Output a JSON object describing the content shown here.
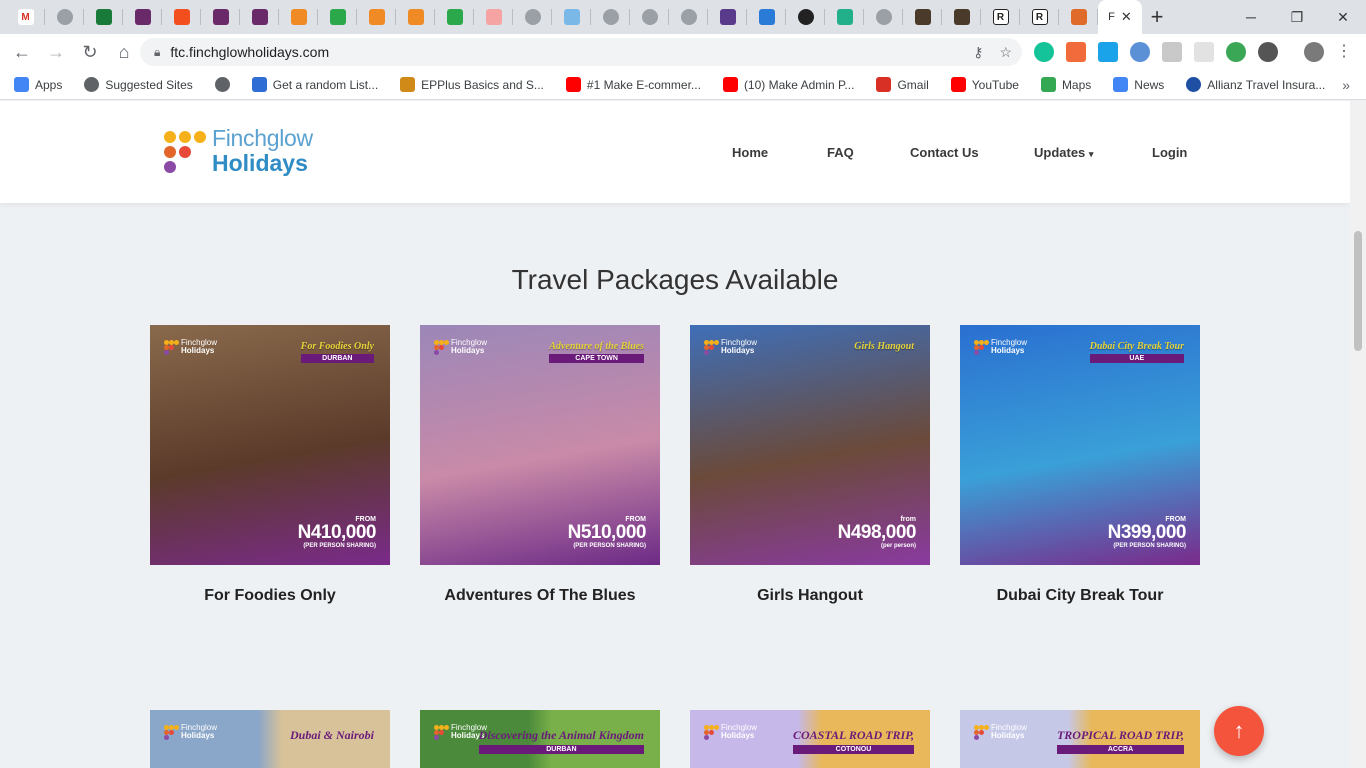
{
  "browser": {
    "active_tab_label": "F",
    "url": "ftc.finchglowholidays.com",
    "tab_favicons": [
      "gmail-icon",
      "globe-icon",
      "grid-icon",
      "grid-icon",
      "figma-icon",
      "grid-icon",
      "grid-icon",
      "box-icon",
      "timer-icon",
      "box-icon",
      "box-icon",
      "timer-icon",
      "laravel-icon",
      "shield-icon",
      "check-icon",
      "globe-icon",
      "shield-icon",
      "shield-icon",
      "bootstrap-icon",
      "code-icon",
      "github-icon",
      "diamond-icon",
      "globe-icon",
      "book-icon",
      "book-icon",
      "r-icon",
      "r-icon",
      "fox-icon"
    ],
    "bookmarks": [
      {
        "label": "Apps",
        "icon": "apps-grid-icon",
        "color": "#4285f4"
      },
      {
        "label": "Suggested Sites",
        "icon": "globe-icon",
        "color": "#5f6368"
      },
      {
        "label": "",
        "icon": "globe-icon",
        "color": "#5f6368"
      },
      {
        "label": "Get a random List...",
        "icon": "arrow-icon",
        "color": "#2f6dd4"
      },
      {
        "label": "EPPlus Basics and S...",
        "icon": "tile-icon",
        "color": "#d08a18"
      },
      {
        "label": "#1 Make E-commer...",
        "icon": "youtube-icon",
        "color": "#ff0000"
      },
      {
        "label": "(10) Make Admin P...",
        "icon": "youtube-icon",
        "color": "#ff0000"
      },
      {
        "label": "Gmail",
        "icon": "gmail-icon",
        "color": "#d93025"
      },
      {
        "label": "YouTube",
        "icon": "youtube-icon",
        "color": "#ff0000"
      },
      {
        "label": "Maps",
        "icon": "maps-icon",
        "color": "#34a853"
      },
      {
        "label": "News",
        "icon": "news-icon",
        "color": "#4285f4"
      },
      {
        "label": "Allianz Travel Insura...",
        "icon": "allianz-icon",
        "color": "#1f4fa3"
      }
    ]
  },
  "site": {
    "logo": {
      "line1": "Finchglow",
      "line2": "Holidays"
    },
    "nav": [
      "Home",
      "FAQ",
      "Contact Us",
      "Updates",
      "Login"
    ],
    "section_title": "Travel Packages Available",
    "packages": [
      {
        "title": "For Foodies Only",
        "badge": "For Foodies Only",
        "badge_sub": "DURBAN",
        "price_from": "FROM",
        "price": "N410,000",
        "price_note": "(PER PERSON SHARING)",
        "colors": [
          "#8a6a4c",
          "#5b3a2a",
          "#7a2a8a"
        ]
      },
      {
        "title": "Adventures Of The Blues",
        "badge": "Adventure of the Blues",
        "badge_sub": "CAPE TOWN",
        "price_from": "FROM",
        "price": "N510,000",
        "price_note": "(PER PERSON SHARING)",
        "colors": [
          "#9b87b8",
          "#c98aa8",
          "#6c2a86"
        ]
      },
      {
        "title": "Girls Hangout",
        "badge": "Girls Hangout",
        "badge_sub": "",
        "price_from": "from",
        "price": "N498,000",
        "price_note": "(per person)",
        "colors": [
          "#3f6fb8",
          "#6b4a3a",
          "#8a3aa0"
        ]
      },
      {
        "title": "Dubai City Break Tour",
        "badge": "Dubai City Break Tour",
        "badge_sub": "UAE",
        "price_from": "FROM",
        "price": "N399,000",
        "price_note": "(PER PERSON SHARING)",
        "colors": [
          "#2a6fd0",
          "#3aa0d8",
          "#7a2a8a"
        ]
      }
    ],
    "packages_row2": [
      {
        "badge": "Dubai & Nairobi",
        "badge_sub": "",
        "colors": [
          "#8aa6c8",
          "#d8c29a"
        ]
      },
      {
        "badge": "Discovering the Animal Kingdom",
        "badge_sub": "DURBAN",
        "colors": [
          "#4a8a3a",
          "#7ab04a"
        ]
      },
      {
        "badge": "COASTAL ROAD TRIP,",
        "badge_sub": "COTONOU",
        "colors": [
          "#c6b8e8",
          "#e8b85a"
        ]
      },
      {
        "badge": "TROPICAL ROAD TRIP,",
        "badge_sub": "ACCRA",
        "colors": [
          "#c6c8e8",
          "#e8b85a"
        ]
      }
    ]
  },
  "brand_colors": {
    "accent": "#f4533c",
    "purple": "#6a1b7a",
    "blue": "#2f8cc4"
  }
}
